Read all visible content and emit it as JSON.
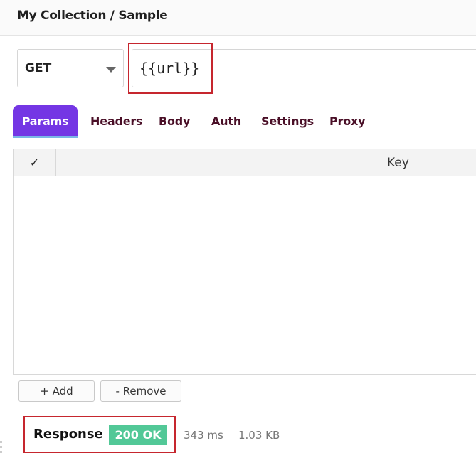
{
  "header": {
    "breadcrumb": "My Collection / Sample"
  },
  "request": {
    "method": "GET",
    "url": "{{url}}"
  },
  "tabs": [
    {
      "label": "Params",
      "active": true
    },
    {
      "label": "Headers",
      "active": false
    },
    {
      "label": "Body",
      "active": false
    },
    {
      "label": "Auth",
      "active": false
    },
    {
      "label": "Settings",
      "active": false
    },
    {
      "label": "Proxy",
      "active": false
    }
  ],
  "params_table": {
    "check_header": "✓",
    "key_header": "Key",
    "rows": []
  },
  "actions": {
    "add_label": "+ Add",
    "remove_label": "- Remove"
  },
  "response": {
    "label": "Response",
    "status": "200 OK",
    "time": "343 ms",
    "size": "1.03 KB"
  },
  "colors": {
    "accent": "#7436e4",
    "status_ok": "#52c897",
    "highlight": "#c6262e"
  }
}
